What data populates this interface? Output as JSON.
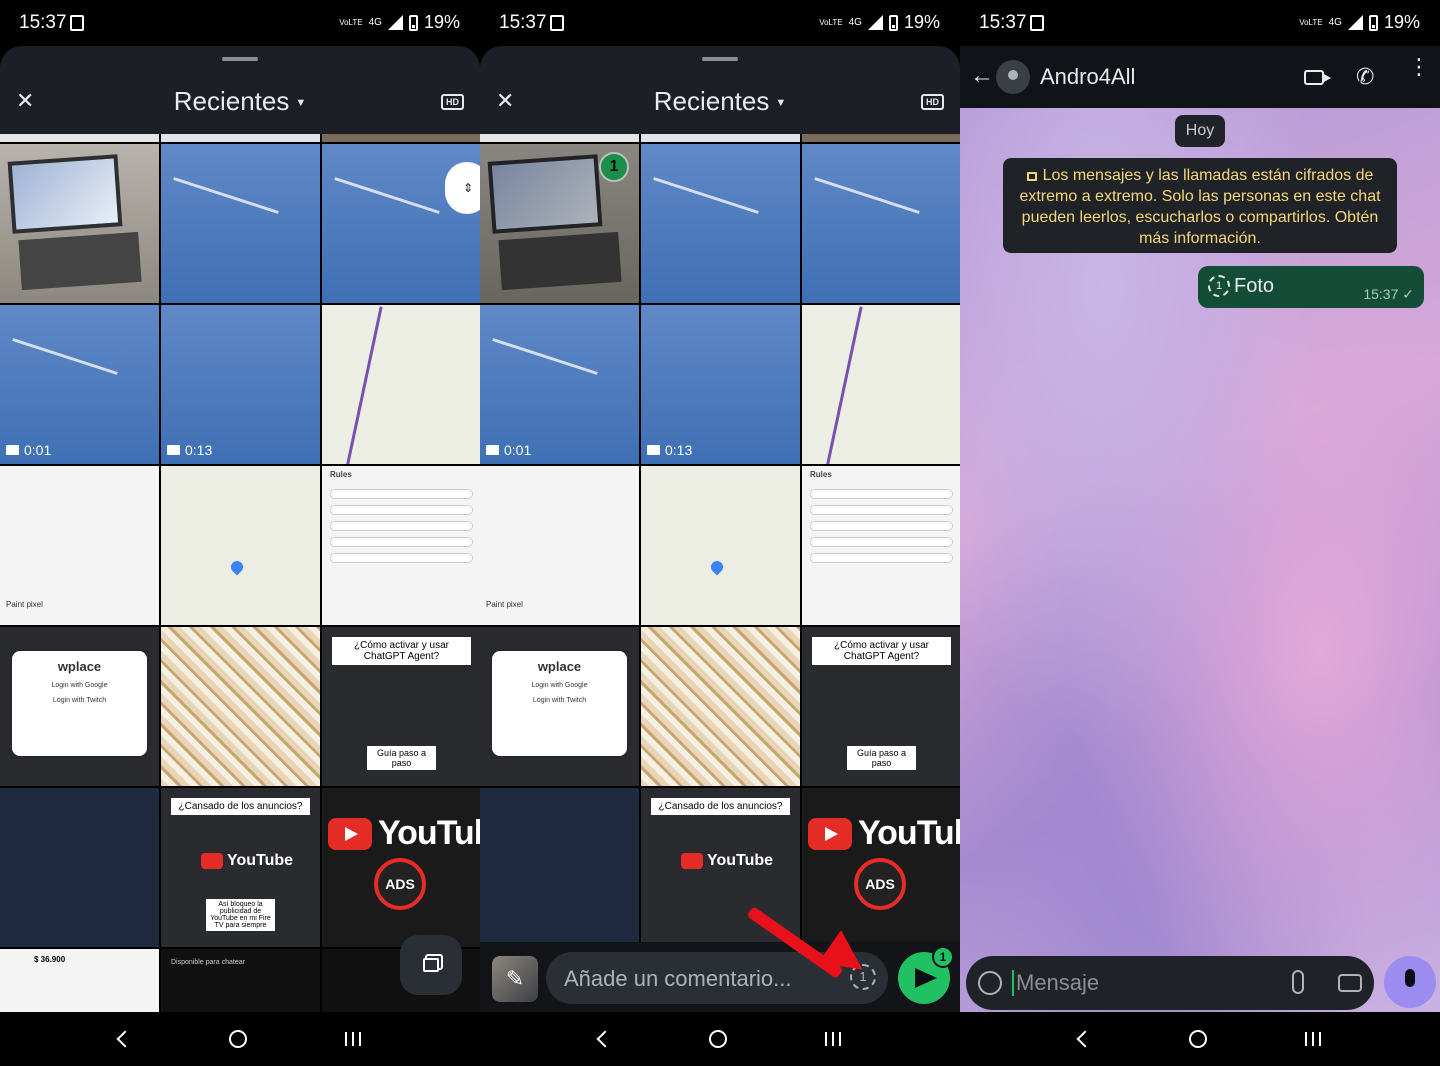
{
  "status_bar": {
    "time": "15:37",
    "volte": "VoLTE",
    "network": "4G",
    "battery": "19%"
  },
  "gallery": {
    "title": "Recientes",
    "close_icon": "close-icon",
    "hd_label": "HD",
    "videos": [
      {
        "duration": "0:01"
      },
      {
        "duration": "0:13"
      }
    ],
    "thumb_texts": {
      "paint_pixel": "Paint pixel",
      "rules": "Rules",
      "wplace": "wplace",
      "login_google": "Login with Google",
      "login_twitch": "Login with Twitch",
      "chatgpt_agent": "¿Cómo activar y usar ChatGPT Agent?",
      "guia": "Guía paso a paso",
      "cansado": "¿Cansado de los anuncios?",
      "youtube": "YouTube",
      "ads": "ADS",
      "bloqueo": "Así bloqueo la publicidad de YouTube en mi Fire TV para siempre",
      "precio": "$ 36.900",
      "disponible": "Disponible para chatear"
    }
  },
  "selection": {
    "count": "1",
    "comment_placeholder": "Añade un comentario..."
  },
  "chat": {
    "contact_name": "Andro4All",
    "day_chip": "Hoy",
    "encryption_notice": "Los mensajes y las llamadas están cifrados de extremo a extremo. Solo las personas en este chat pueden leerlos, escucharlos o compartirlos. Obtén más información.",
    "message": {
      "label": "Foto",
      "time": "15:37 ✓",
      "view_once": "1"
    },
    "input_placeholder": "Mensaje"
  },
  "colors": {
    "accent_green": "#21c063",
    "arrow_red": "#e8101a",
    "bubble_green": "#144d37",
    "mic_purple": "#9d8cf0"
  }
}
